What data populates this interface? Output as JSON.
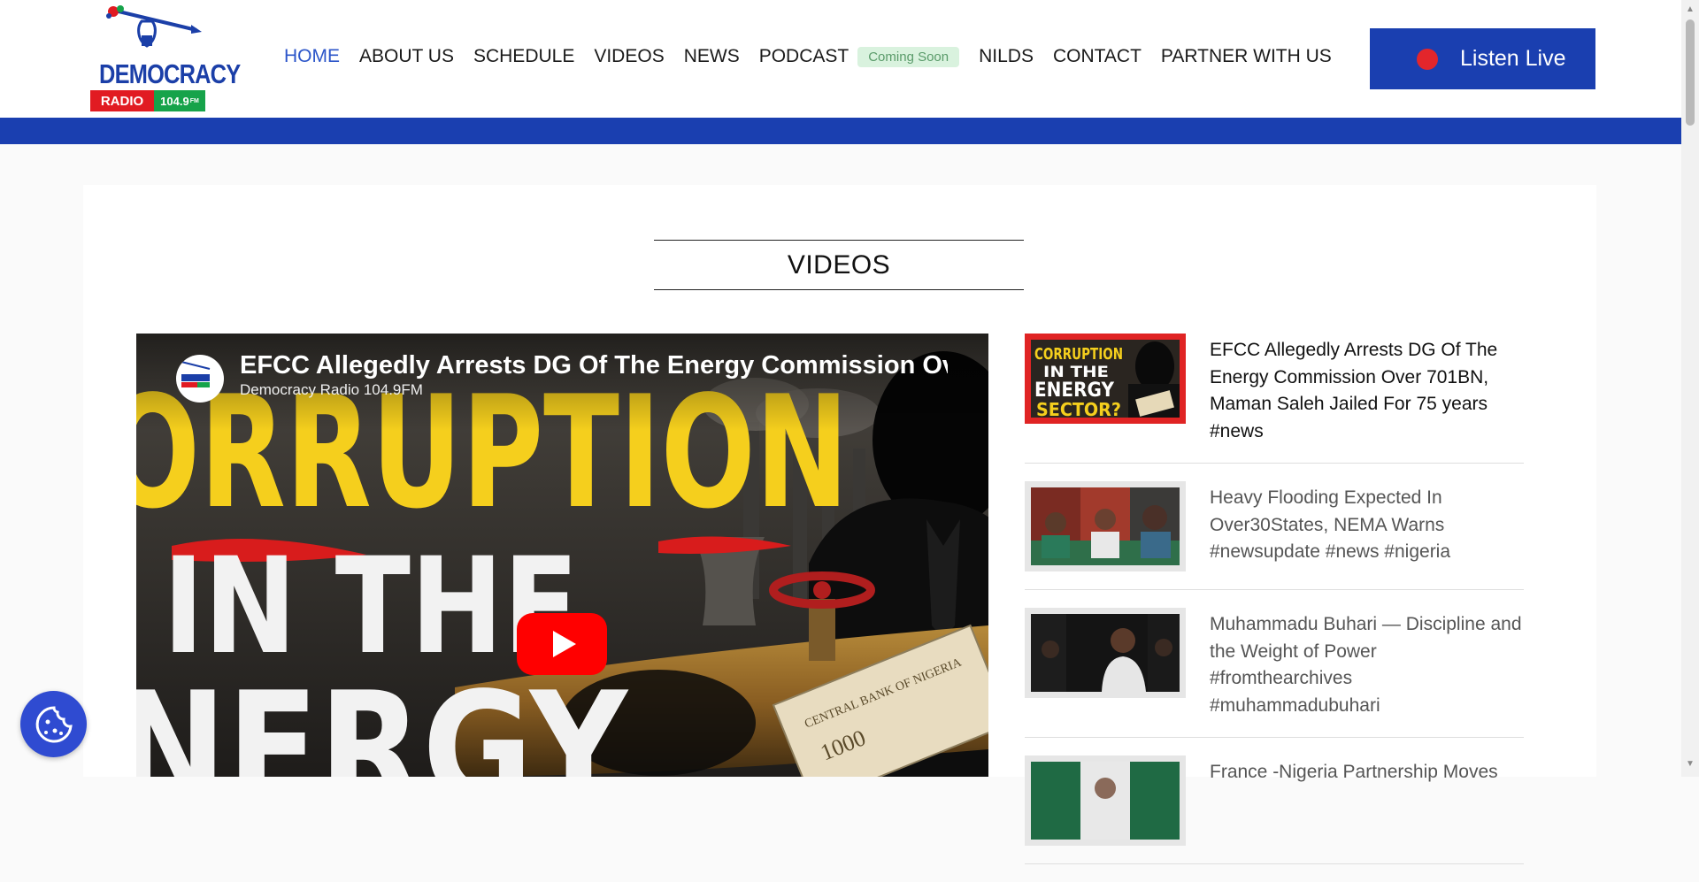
{
  "logo": {
    "word": "DEMOCRACY",
    "radio": "RADIO",
    "freq": "104.9",
    "freq_unit": "FM"
  },
  "nav": {
    "items": [
      "HOME",
      "ABOUT US",
      "SCHEDULE",
      "VIDEOS",
      "NEWS",
      "PODCAST",
      "NILDS",
      "CONTACT",
      "PARTNER WITH US"
    ],
    "active": "HOME",
    "podcast_badge": "Coming Soon"
  },
  "listen_button": {
    "label": "Listen Live"
  },
  "section": {
    "title": "VIDEOS"
  },
  "player": {
    "title": "EFCC Allegedly Arrests DG Of The Energy Commission Over",
    "channel": "Democracy Radio 104.9FM",
    "thumbnail_text": [
      "ORRUPTION",
      "IN THE",
      "NERGY"
    ],
    "banknote_text": "CENTRAL BANK OF NIGERIA",
    "banknote_value": "1000"
  },
  "videos": [
    {
      "title": "EFCC Allegedly Arrests DG Of The Energy Commission Over 701BN, Maman Saleh Jailed For 75 years #news",
      "thumb_text": [
        "CORRUPTION",
        "IN THE",
        "ENERGY",
        "SECTOR?"
      ]
    },
    {
      "title": "Heavy Flooding Expected In Over30States, NEMA Warns #newsupdate #news #nigeria"
    },
    {
      "title": "Muhammadu Buhari — Discipline and the Weight of Power #fromthearchives #muhammadubuhari"
    },
    {
      "title": "France -Nigeria Partnership Moves"
    }
  ],
  "colors": {
    "brand_blue": "#1a3fb0",
    "nav_active": "#2b55c9",
    "youtube_red": "#ff0000",
    "live_dot": "#e3262b",
    "badge_bg": "#d9f2de"
  }
}
